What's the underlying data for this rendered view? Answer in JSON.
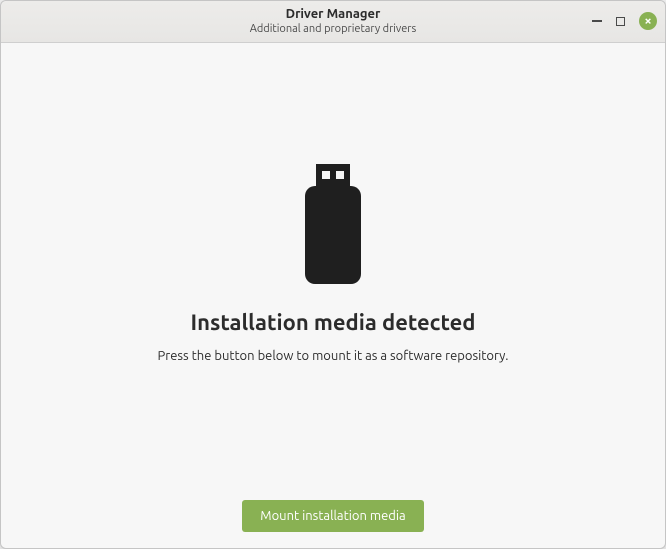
{
  "titlebar": {
    "title": "Driver Manager",
    "subtitle": "Additional and proprietary drivers"
  },
  "content": {
    "heading": "Installation media detected",
    "description": "Press the button below to mount it as a software repository."
  },
  "footer": {
    "button_label": "Mount installation media"
  },
  "colors": {
    "accent": "#89b153"
  }
}
